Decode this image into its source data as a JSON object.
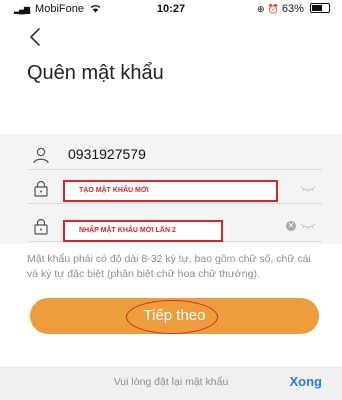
{
  "status_bar": {
    "carrier": "MobiFone",
    "time": "10:27",
    "battery": "63%"
  },
  "header": {
    "back_icon": "chevron-left-icon",
    "title": "Quên mật khẩu"
  },
  "form": {
    "phone": {
      "icon": "user-icon",
      "value": "0931927579"
    },
    "new_password": {
      "icon": "lock-icon",
      "annotation": "TẠO MẬT KHẨU MỚI",
      "toggle_icon": "eye-closed-icon"
    },
    "confirm_password": {
      "icon": "lock-icon",
      "annotation": "NHẬP MẬT KHẨU MỚI LẦN 2",
      "clear_icon": "clear-icon",
      "toggle_icon": "eye-closed-icon"
    },
    "hint": "Mật khẩu phải có độ dài 8-32 ký tự, bao gồm chữ số, chữ cái và ký tự đặc biệt (phân biệt chữ hoa chữ thường)."
  },
  "next_button": {
    "label": "Tiếp theo"
  },
  "bottom_bar": {
    "message": "Vui lòng đặt lại mật khẩu",
    "done_label": "Xong"
  },
  "colors": {
    "accent": "#ed9d3e",
    "annotation_red": "#d22828",
    "link_blue": "#2f7bd6"
  }
}
